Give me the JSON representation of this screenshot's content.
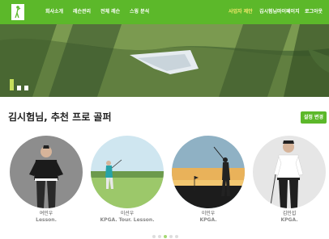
{
  "nav": {
    "items": [
      {
        "label": "회사소개",
        "highlight": false
      },
      {
        "label": "레슨관리",
        "highlight": false
      },
      {
        "label": "전체 레슨",
        "highlight": false
      },
      {
        "label": "스윙 분석",
        "highlight": false
      }
    ],
    "right_items": [
      {
        "label": "사업자 제안",
        "highlight": true
      },
      {
        "label": "김시험님",
        "highlight": false
      },
      {
        "label": "마이페이지",
        "highlight": false
      },
      {
        "label": "로그아웃",
        "highlight": false
      }
    ],
    "bg_color": "#5cb82a",
    "highlight_color": "#f4e96b"
  },
  "hero": {
    "slide_indicator_count": 3,
    "active_indicator": 0
  },
  "section": {
    "title": "김시험님, 추천 프로 골퍼",
    "settings_button": "설정 변경"
  },
  "pros": [
    {
      "name": "여민우",
      "tags": "Lesson."
    },
    {
      "name": "이선우",
      "tags": "KPGA. Tour. Lesson."
    },
    {
      "name": "이민우",
      "tags": "KPGA."
    },
    {
      "name": "김민섭",
      "tags": "KPGA."
    }
  ],
  "pager": {
    "count": 5,
    "active": 2
  }
}
